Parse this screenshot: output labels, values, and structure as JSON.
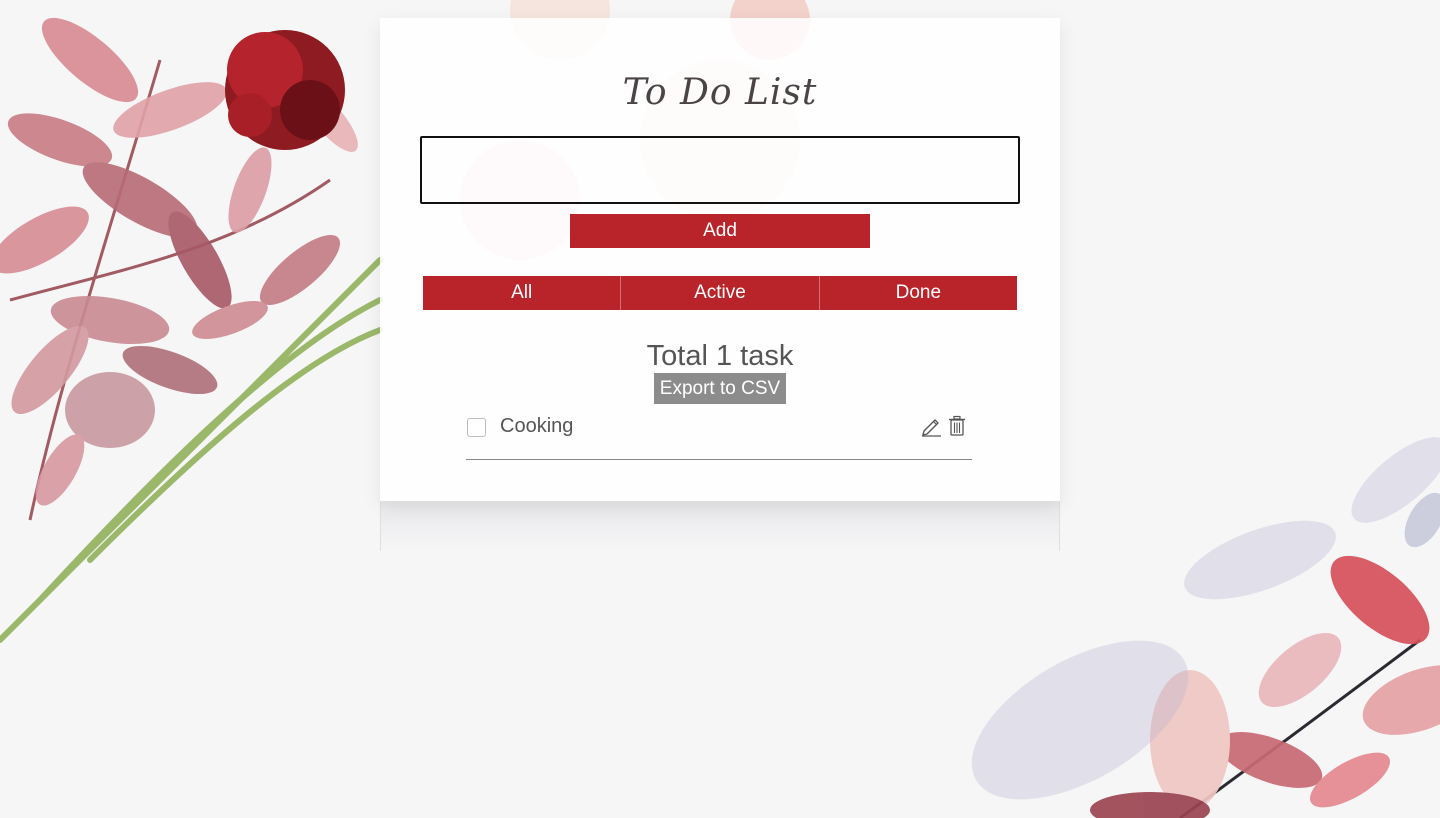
{
  "app": {
    "title": "To Do List"
  },
  "input": {
    "value": "",
    "placeholder": ""
  },
  "actions": {
    "add_label": "Add",
    "export_label": "Export to CSV"
  },
  "filters": [
    {
      "label": "All"
    },
    {
      "label": "Active"
    },
    {
      "label": "Done"
    }
  ],
  "summary": {
    "total_text": "Total 1 task"
  },
  "tasks": [
    {
      "label": "Cooking",
      "done": false
    }
  ],
  "icons": {
    "edit": "pencil-icon",
    "delete": "trash-icon"
  },
  "colors": {
    "accent": "#b9242b",
    "export_button": "#8c8c8c",
    "text": "#555555",
    "title": "#4b4444"
  }
}
